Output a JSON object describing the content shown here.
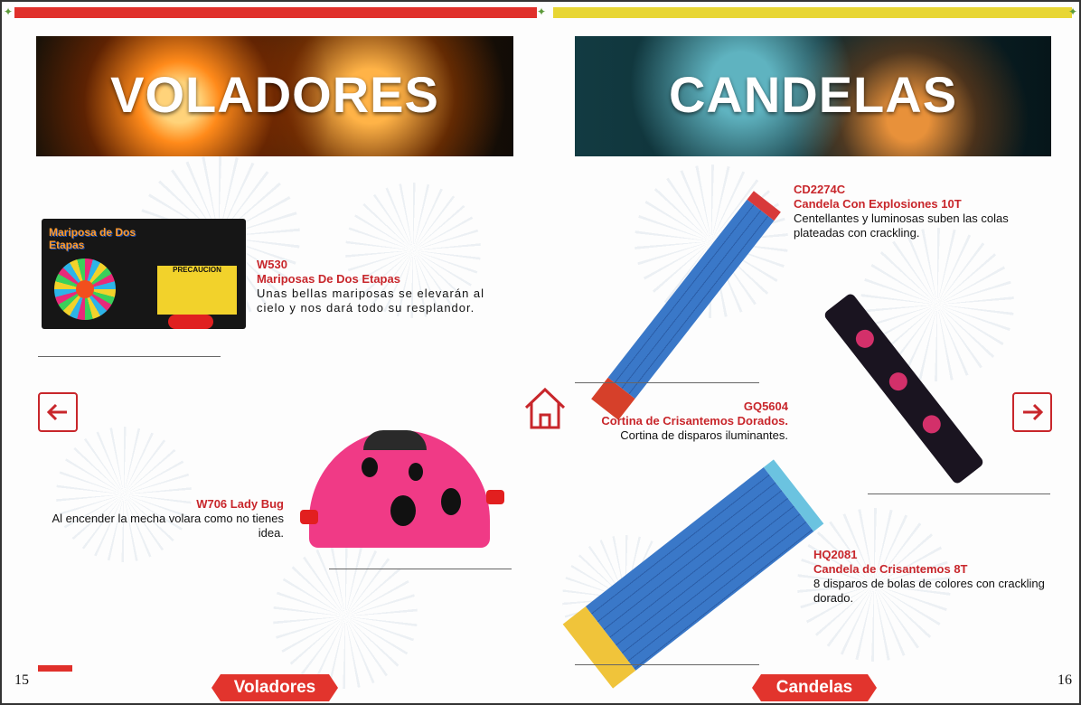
{
  "left_page": {
    "banner_title": "VOLADORES",
    "page_number": "15",
    "footer_label": "Voladores",
    "products": [
      {
        "code": "W530",
        "name": "Mariposas De Dos Etapas",
        "description": "Unas bellas mariposas se elevarán al cielo y nos dará todo su resplandor.",
        "package_text": "Mariposa de Dos Etapas",
        "package_warning": "PRECAUCION"
      },
      {
        "code": "W706 Lady Bug",
        "name": "",
        "description": "Al encender la mecha volara como no tienes idea."
      }
    ]
  },
  "right_page": {
    "banner_title": "CANDELAS",
    "page_number": "16",
    "footer_label": "Candelas",
    "products": [
      {
        "code": "CD2274C",
        "name": "Candela Con Explosiones 10T",
        "description": "Centellantes y luminosas suben las colas plateadas con crackling."
      },
      {
        "code": "GQ5604",
        "name": "Cortina de Crisantemos Dorados.",
        "description": "Cortina de disparos iluminantes."
      },
      {
        "code": "HQ2081",
        "name": "Candela de Crisantemos 8T",
        "description": "8 disparos de bolas de colores con crackling dorado."
      }
    ]
  },
  "colors": {
    "accent_red": "#c8262b",
    "top_bar_red": "#e0302b",
    "top_bar_yellow": "#e8d634"
  },
  "icons": {
    "back": "arrow-left-icon",
    "forward": "arrow-right-icon",
    "home": "home-icon"
  }
}
